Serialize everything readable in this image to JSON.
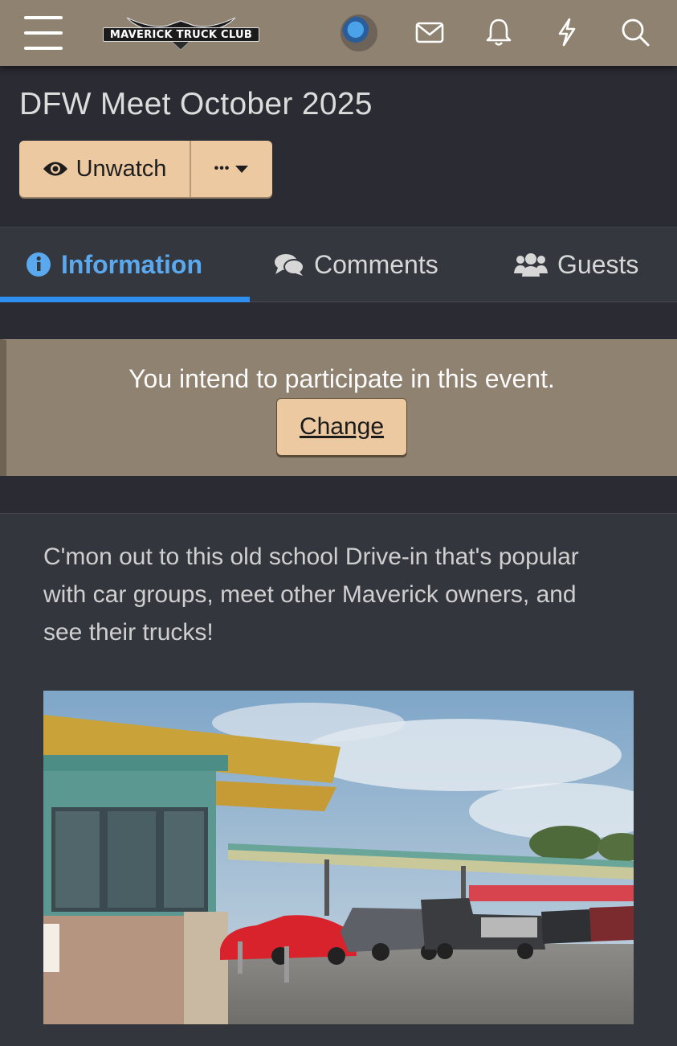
{
  "header": {
    "logo_text": "MAVERICK TRUCK CLUB",
    "icons": [
      "menu-icon",
      "avatar",
      "envelope-icon",
      "bell-icon",
      "bolt-icon",
      "search-icon"
    ]
  },
  "event": {
    "title": "DFW Meet October 2025",
    "unwatch_label": "Unwatch",
    "more_label": "•••"
  },
  "tabs": [
    {
      "label": "Information",
      "icon": "info-circle-icon",
      "active": true
    },
    {
      "label": "Comments",
      "icon": "comments-icon",
      "active": false
    },
    {
      "label": "Guests",
      "icon": "users-icon",
      "active": false
    }
  ],
  "notice": {
    "text": "You intend to participate in this event.",
    "change_label": "Change"
  },
  "description": "C'mon out to this old school Drive-in that's popular with car groups, meet other Maverick owners, and see their trucks!",
  "colors": {
    "header_bg": "#8f8270",
    "page_bg": "#2b2c33",
    "button_bg": "#ecc9a0",
    "active_tab": "#5aa9ee",
    "tab_indicator": "#2f8ff0"
  }
}
